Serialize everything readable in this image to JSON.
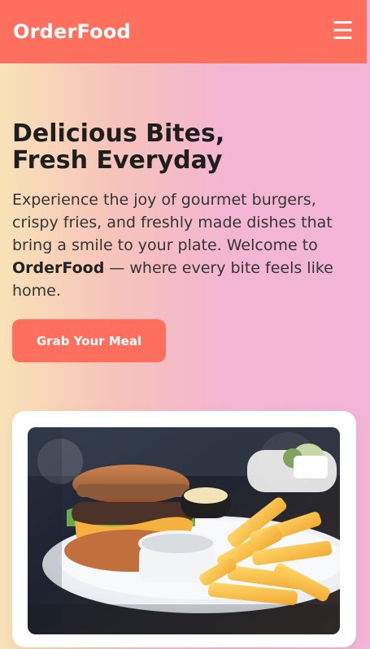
{
  "header": {
    "brand": "OrderFood",
    "menu_icon": "☰"
  },
  "hero": {
    "title_line1": "Delicious Bites,",
    "title_line2": "Fresh Everyday",
    "text_part1": "Experience the joy of gourmet burgers, crispy fries, and freshly made dishes that bring a smile to your plate. Welcome to ",
    "text_brand": "OrderFood",
    "text_part2": " — where every bite feels like home.",
    "cta_label": "Grab Your Meal"
  },
  "colors": {
    "accent": "#ff6f5e"
  }
}
